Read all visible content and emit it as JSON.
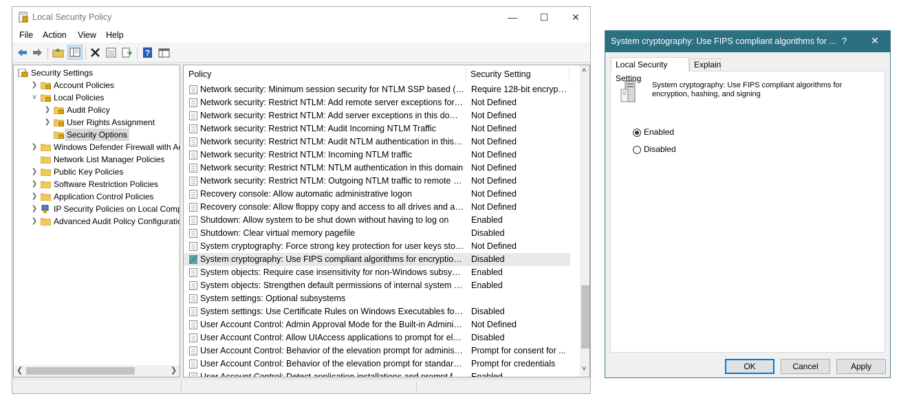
{
  "main_window": {
    "title": "Local Security Policy",
    "menu": [
      "File",
      "Action",
      "View",
      "Help"
    ],
    "toolbar_icons": [
      "back-arrow-icon",
      "forward-arrow-icon",
      "up-folder-icon",
      "show-hide-tree-icon",
      "delete-icon",
      "properties-icon",
      "export-list-icon",
      "help-icon",
      "console-icon"
    ]
  },
  "tree": {
    "items": [
      {
        "label": "Security Settings",
        "indent": 0,
        "expander": "",
        "icon": "shield-icon"
      },
      {
        "label": "Account Policies",
        "indent": 1,
        "expander": ">",
        "icon": "folder-lock-icon"
      },
      {
        "label": "Local Policies",
        "indent": 1,
        "expander": "v",
        "icon": "folder-lock-icon"
      },
      {
        "label": "Audit Policy",
        "indent": 2,
        "expander": ">",
        "icon": "folder-lock-icon"
      },
      {
        "label": "User Rights Assignment",
        "indent": 2,
        "expander": ">",
        "icon": "folder-lock-icon"
      },
      {
        "label": "Security Options",
        "indent": 2,
        "expander": "",
        "icon": "folder-lock-icon",
        "selected": true
      },
      {
        "label": "Windows Defender Firewall with Adva",
        "indent": 1,
        "expander": ">",
        "icon": "folder-icon"
      },
      {
        "label": "Network List Manager Policies",
        "indent": 1,
        "expander": "",
        "icon": "folder-icon"
      },
      {
        "label": "Public Key Policies",
        "indent": 1,
        "expander": ">",
        "icon": "folder-icon"
      },
      {
        "label": "Software Restriction Policies",
        "indent": 1,
        "expander": ">",
        "icon": "folder-icon"
      },
      {
        "label": "Application Control Policies",
        "indent": 1,
        "expander": ">",
        "icon": "folder-icon"
      },
      {
        "label": "IP Security Policies on Local Compute",
        "indent": 1,
        "expander": ">",
        "icon": "network-shield-icon"
      },
      {
        "label": "Advanced Audit Policy Configuration",
        "indent": 1,
        "expander": ">",
        "icon": "folder-icon"
      }
    ]
  },
  "list": {
    "columns": [
      "Policy",
      "Security Setting"
    ],
    "rows": [
      {
        "policy": "Network security: Minimum session security for NTLM SSP based (inclu...",
        "setting": "Require 128-bit encrypti..."
      },
      {
        "policy": "Network security: Restrict NTLM: Add remote server exceptions for NTL...",
        "setting": "Not Defined"
      },
      {
        "policy": "Network security: Restrict NTLM: Add server exceptions in this domain",
        "setting": "Not Defined"
      },
      {
        "policy": "Network security: Restrict NTLM: Audit Incoming NTLM Traffic",
        "setting": "Not Defined"
      },
      {
        "policy": "Network security: Restrict NTLM: Audit NTLM authentication in this do...",
        "setting": "Not Defined"
      },
      {
        "policy": "Network security: Restrict NTLM: Incoming NTLM traffic",
        "setting": "Not Defined"
      },
      {
        "policy": "Network security: Restrict NTLM: NTLM authentication in this domain",
        "setting": "Not Defined"
      },
      {
        "policy": "Network security: Restrict NTLM: Outgoing NTLM traffic to remote serv...",
        "setting": "Not Defined"
      },
      {
        "policy": "Recovery console: Allow automatic administrative logon",
        "setting": "Not Defined"
      },
      {
        "policy": "Recovery console: Allow floppy copy and access to all drives and all fol...",
        "setting": "Not Defined"
      },
      {
        "policy": "Shutdown: Allow system to be shut down without having to log on",
        "setting": "Enabled"
      },
      {
        "policy": "Shutdown: Clear virtual memory pagefile",
        "setting": "Disabled"
      },
      {
        "policy": "System cryptography: Force strong key protection for user keys stored ...",
        "setting": "Not Defined"
      },
      {
        "policy": "System cryptography: Use FIPS compliant algorithms for encryption, ha...",
        "setting": "Disabled",
        "selected": true
      },
      {
        "policy": "System objects: Require case insensitivity for non-Windows subsystems",
        "setting": "Enabled"
      },
      {
        "policy": "System objects: Strengthen default permissions of internal system obje...",
        "setting": "Enabled"
      },
      {
        "policy": "System settings: Optional subsystems",
        "setting": ""
      },
      {
        "policy": "System settings: Use Certificate Rules on Windows Executables for Soft...",
        "setting": "Disabled"
      },
      {
        "policy": "User Account Control: Admin Approval Mode for the Built-in Administr...",
        "setting": "Not Defined"
      },
      {
        "policy": "User Account Control: Allow UIAccess applications to prompt for elevat...",
        "setting": "Disabled"
      },
      {
        "policy": "User Account Control: Behavior of the elevation prompt for administrat...",
        "setting": "Prompt for consent for ..."
      },
      {
        "policy": "User Account Control: Behavior of the elevation prompt for standard us...",
        "setting": "Prompt for credentials"
      },
      {
        "policy": "User Account Control: Detect application installations and prompt for e...",
        "setting": "Enabled"
      }
    ]
  },
  "dialog": {
    "title": "System cryptography: Use FIPS compliant algorithms for ...",
    "help_button": "?",
    "tabs": [
      "Local Security Setting",
      "Explain"
    ],
    "description": [
      "System cryptography: Use FIPS compliant algorithms for",
      "encryption, hashing, and signing"
    ],
    "options": [
      {
        "label": "Enabled",
        "checked": true
      },
      {
        "label": "Disabled",
        "checked": false
      }
    ],
    "buttons": {
      "ok": "OK",
      "cancel": "Cancel",
      "apply": "Apply"
    }
  },
  "colors": {
    "dialog_title_bg": "#2b6f80",
    "selection_bg": "#cce8ff",
    "row_highlight": "#e8e8e8",
    "accent": "#0078d7"
  }
}
